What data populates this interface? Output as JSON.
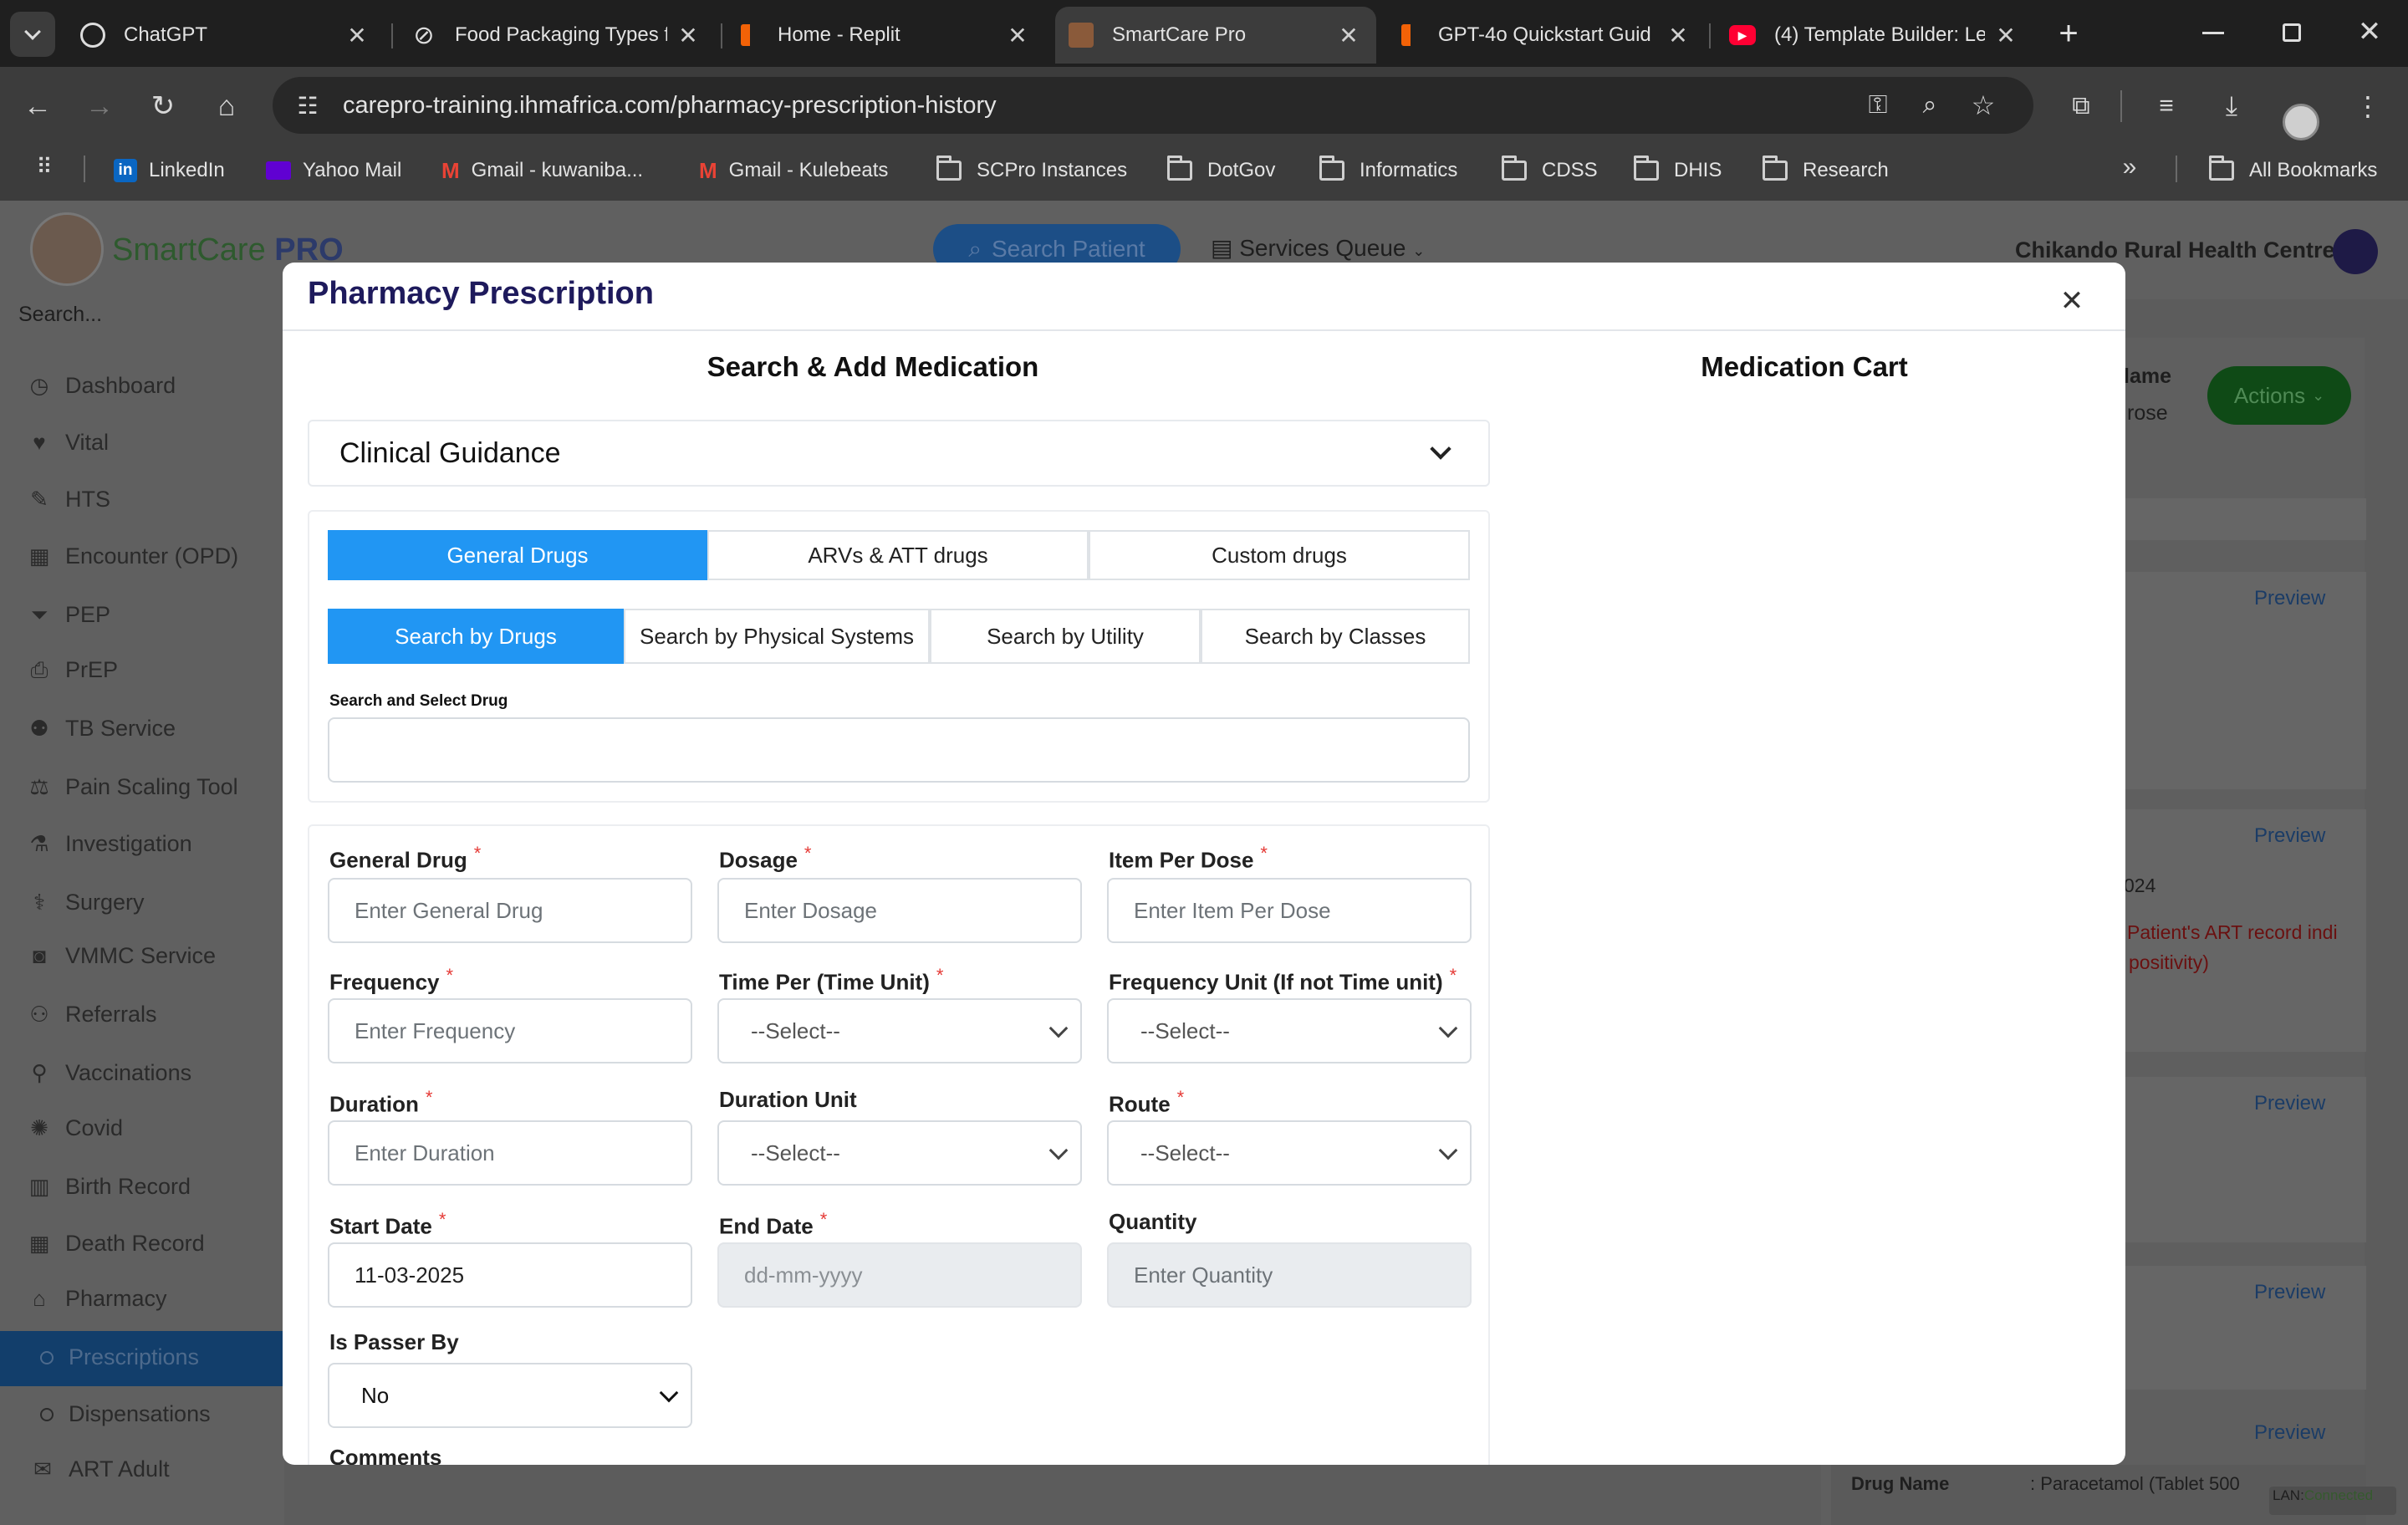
{
  "browser": {
    "tabs": [
      {
        "title": "ChatGPT",
        "icon": "chatgpt-icon"
      },
      {
        "title": "Food Packaging Types f",
        "icon": "perplexity-icon"
      },
      {
        "title": "Home - Replit",
        "icon": "replit-icon"
      },
      {
        "title": "SmartCare Pro",
        "icon": "zambia-coat-of-arms-icon"
      },
      {
        "title": "GPT-4o Quickstart Guid",
        "icon": "replit-icon"
      },
      {
        "title": "(4) Template Builder: Le",
        "icon": "youtube-icon"
      }
    ],
    "url": "carepro-training.ihmafrica.com/pharmacy-prescription-history",
    "bookmarks": [
      "LinkedIn",
      "Yahoo Mail",
      "Gmail - kuwaniba...",
      "Gmail - Kulebeats",
      "SCPro Instances",
      "DotGov",
      "Informatics",
      "CDSS",
      "DHIS",
      "Research"
    ],
    "all_bookmarks": "All Bookmarks",
    "new_tab": "+"
  },
  "app": {
    "brand": "SmartCare",
    "brand_suffix": "PRO",
    "search_patient": "Search Patient",
    "services_queue": "Services Queue",
    "facility": "Chikando Rural Health Centre",
    "sidebar_search": "Search...",
    "sidebar": [
      {
        "label": "Dashboard",
        "icon": "dashboard-icon"
      },
      {
        "label": "Vital",
        "icon": "heart-pulse-icon"
      },
      {
        "label": "HTS",
        "icon": "pen-icon"
      },
      {
        "label": "Encounter (OPD)",
        "icon": "hospital-icon"
      },
      {
        "label": "PEP",
        "icon": "filter-icon"
      },
      {
        "label": "PrEP",
        "icon": "printer-icon"
      },
      {
        "label": "TB Service",
        "icon": "people-icon"
      },
      {
        "label": "Pain Scaling Tool",
        "icon": "scale-icon"
      },
      {
        "label": "Investigation",
        "icon": "flask-icon"
      },
      {
        "label": "Surgery",
        "icon": "scalpel-icon"
      },
      {
        "label": "VMMC Service",
        "icon": "camera-icon"
      },
      {
        "label": "Referrals",
        "icon": "referral-icon"
      },
      {
        "label": "Vaccinations",
        "icon": "syringe-icon"
      },
      {
        "label": "Covid",
        "icon": "virus-icon"
      },
      {
        "label": "Birth Record",
        "icon": "chart-icon"
      },
      {
        "label": "Death Record",
        "icon": "hospital-icon"
      },
      {
        "label": "Pharmacy",
        "icon": "pharmacy-icon"
      },
      {
        "label": "Prescriptions",
        "icon": "circle-icon"
      },
      {
        "label": "Dispensations",
        "icon": "circle-icon"
      },
      {
        "label": "ART Adult",
        "icon": "art-icon"
      }
    ],
    "background": {
      "name_header": "lame",
      "name_value": "rose",
      "actions": "Actions",
      "previews": [
        "Preview",
        "Preview",
        "Preview",
        "Preview",
        "Preview"
      ],
      "year_fragment": "024",
      "alert_line1": "Patient's ART record indi",
      "alert_line2": "positivity)",
      "drug_name_label": "Drug Name",
      "drug_name_value": ": Paracetamol (Tablet 500",
      "lan": "LAN",
      "connected": "Connected"
    }
  },
  "modal": {
    "title": "Pharmacy Prescription",
    "left_heading": "Search & Add Medication",
    "right_heading": "Medication Cart",
    "clinical_guidance": "Clinical Guidance",
    "drug_tabs": [
      "General Drugs",
      "ARVs & ATT drugs",
      "Custom drugs"
    ],
    "search_tabs": [
      "Search by Drugs",
      "Search by Physical Systems",
      "Search by Utility",
      "Search by Classes"
    ],
    "search_label": "Search and Select Drug",
    "search_value": "",
    "fields": {
      "general_drug": {
        "label": "General Drug",
        "placeholder": "Enter General Drug",
        "required": "*"
      },
      "dosage": {
        "label": "Dosage",
        "placeholder": "Enter Dosage",
        "required": "*"
      },
      "item_per_dose": {
        "label": "Item Per Dose",
        "placeholder": "Enter Item Per Dose",
        "required": "*"
      },
      "frequency": {
        "label": "Frequency",
        "placeholder": "Enter Frequency",
        "required": "*"
      },
      "time_per": {
        "label": "Time Per (Time Unit)",
        "value": "--Select--",
        "required": "*"
      },
      "frequency_unit": {
        "label": "Frequency Unit (If not Time unit)",
        "value": "--Select--",
        "required": "*"
      },
      "duration": {
        "label": "Duration",
        "placeholder": "Enter Duration",
        "required": "*"
      },
      "duration_unit": {
        "label": "Duration Unit",
        "value": "--Select--"
      },
      "route": {
        "label": "Route",
        "value": "--Select--",
        "required": "*"
      },
      "start_date": {
        "label": "Start Date",
        "value": "11-03-2025",
        "required": "*"
      },
      "end_date": {
        "label": "End Date",
        "placeholder": "dd-mm-yyyy",
        "required": "*"
      },
      "quantity": {
        "label": "Quantity",
        "placeholder": "Enter Quantity"
      },
      "is_passer_by": {
        "label": "Is Passer By",
        "value": "No"
      },
      "comments": {
        "label": "Comments"
      }
    }
  }
}
